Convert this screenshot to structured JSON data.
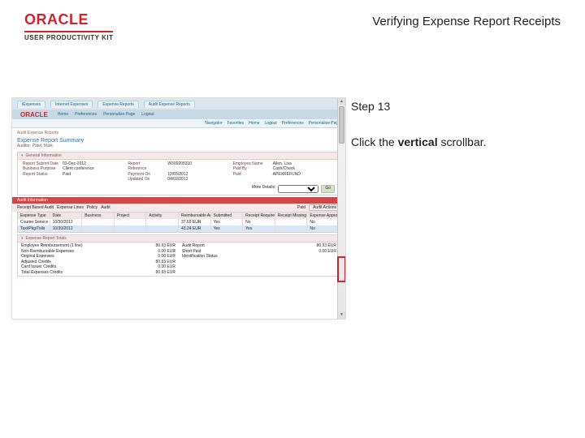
{
  "header": {
    "brand": "ORACLE",
    "product": "USER PRODUCTIVITY KIT",
    "page_title": "Verifying Expense Report Receipts"
  },
  "instruction": {
    "step_label": "Step 13",
    "text_pre": "Click the ",
    "text_bold": "vertical",
    "text_post": " scrollbar."
  },
  "screenshot": {
    "brand": "ORACLE",
    "tabs": [
      "iExpenses",
      "Internet Expenses",
      "Expense Reports",
      "Audit Expense Reports"
    ],
    "links": [
      "Home",
      "Preferences",
      "Personalize Page",
      "Logout"
    ],
    "menu": [
      "Navigator",
      "Favorites",
      "Home",
      "Logout",
      "Preferences",
      "Personalize Page"
    ],
    "breadcrumb": "Audit Expense Reports",
    "title": "Expense Report Summary",
    "subtitle": "Auditor: Patel, Mark",
    "section_general": "General Information",
    "general": {
      "col1": [
        {
          "k": "Report Submit Date",
          "v": "03-Dec-2012"
        },
        {
          "k": "Business Purpose",
          "v": "Client conference"
        },
        {
          "k": "Report Status",
          "v": "Paid"
        }
      ],
      "col2": [
        {
          "k": "Report",
          "v": "W300208310"
        },
        {
          "k": "Reference",
          "v": ""
        },
        {
          "k": "Payment On",
          "v": "12/03/2012"
        },
        {
          "k": "Updated On",
          "v": "04/02/2012"
        }
      ],
      "col3": [
        {
          "k": "Employee Name",
          "v": "Allen, Lisa"
        },
        {
          "k": "Paid By",
          "v": "Cash/Check"
        },
        {
          "k": "Paid",
          "v": "APEXREFUND"
        }
      ]
    },
    "more_label": "More Details:",
    "go_label": "Go",
    "audit_header": "Audit Information",
    "toolrow": [
      "Receipt Based Audit",
      "Expense Lines",
      "Policy",
      "Audit"
    ],
    "toolrow_right": [
      "Paid",
      "Audit Actions"
    ],
    "table": {
      "headers": [
        "Expense Type",
        "Date",
        "Business",
        "Project",
        "Activity",
        "Reimbursable Amount",
        "Submitted",
        "Receipt Required",
        "Receipt Missing",
        "Expense Approved"
      ],
      "rows": [
        [
          "Courier Service",
          "10/30/2012",
          "",
          "",
          "",
          "37.69 EUR",
          "Yes",
          "No",
          "",
          "No"
        ],
        [
          "Taxi/Pkg/Tolls",
          "10/30/2012",
          "",
          "",
          "",
          "43.24 EUR",
          "Yes",
          "Yes",
          "",
          "No"
        ]
      ]
    },
    "summary_header": "Expense Report Totals",
    "summary": {
      "left": [
        {
          "k": "Employee Reimbursement (1 line)",
          "v": "80.93 EUR"
        },
        {
          "k": "Non-Reimbursable Expenses",
          "v": "0.00 EUR"
        },
        {
          "k": "Original Expenses",
          "v": "0.00 EUR"
        },
        {
          "k": "Adjusted Credits",
          "v": "80.93 EUR"
        },
        {
          "k": "Card Issuer Credits",
          "v": "0.00 EUR"
        },
        {
          "k": "Total Expenses Credits",
          "v": "80.93 EUR"
        }
      ],
      "right": [
        {
          "k": "Audit Report",
          "v": "80.93 EUR"
        },
        {
          "k": "Short Paid",
          "v": "0.00 EUR"
        },
        {
          "k": "Identification Status",
          "v": ""
        }
      ]
    }
  }
}
